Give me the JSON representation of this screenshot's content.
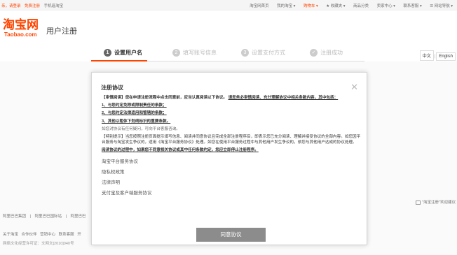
{
  "topbar": {
    "left": [
      "亲，请登录",
      "免费注册",
      "手机逛淘宝"
    ],
    "right": [
      "淘宝网首页",
      "我的淘宝 ▾",
      "购物车 ▾",
      "★ 收藏夹 ▾",
      "商品分类",
      "卖家中心 ▾",
      "联系客服 ▾",
      "☰ 网站导航 ▾"
    ]
  },
  "header": {
    "logo_cn": "淘宝网",
    "logo_en": "Taobao.com",
    "title": "用户注册"
  },
  "steps": [
    {
      "num": "1",
      "label": "设置用户名",
      "active": true
    },
    {
      "num": "2",
      "label": "填写账号信息",
      "active": false
    },
    {
      "num": "3",
      "label": "设置支付方式",
      "active": false
    },
    {
      "num": "✓",
      "label": "注册成功",
      "active": false
    }
  ],
  "lang": {
    "cn": "中文",
    "sep": "|",
    "en": "English"
  },
  "modal": {
    "title": "注册协议",
    "close": "✕",
    "p1_pre": "【审慎阅读】您在申请注册流程中点击同意前，应当认真阅读以下协议。",
    "p1_strong": "请您务必审慎阅读、充分理解协议中相关条款内容，其中包括：",
    "items": [
      "1、与您约定免除或限制责任的条款；",
      "2、与您约定法律适用和管辖的条款；",
      "3、其他以粗体下划线标识的重要条款。"
    ],
    "p2": "如您对协议有任何疑问，可向平台客服咨询。",
    "p3": "【特别提示】当您按照注册页面提示填写信息、阅读并同意协议且完成全部注册程序后，即表示您已充分阅读、理解并接受协议的全部内容。如您因平台服务与淘宝发生争议的，适用《淘宝平台服务协议》处理。如您在使用平台服务过程中与其他用户发生争议的，依您与其他用户达成的协议处理。",
    "p4": "阅读协议的过程中，如果您不同意相关协议或其中任何条款约定，您应立即停止注册程序。",
    "links": [
      "淘宝平台服务协议",
      "隐私权政策",
      "法律声明",
      "支付宝及客户端服务协议"
    ],
    "agree": "同意协议"
  },
  "footer": {
    "row1": [
      "阿里巴巴集团",
      "|",
      "阿里巴巴国际站",
      "|",
      "阿里巴巴"
    ],
    "row2": [
      "关于淘宝",
      "合作伙伴",
      "营销中心",
      "联系客服",
      "开"
    ],
    "row3": "网络文化经营许可证：文网文[2010]040号"
  },
  "right_note": "\"淘宝注册\"欢迎建议"
}
